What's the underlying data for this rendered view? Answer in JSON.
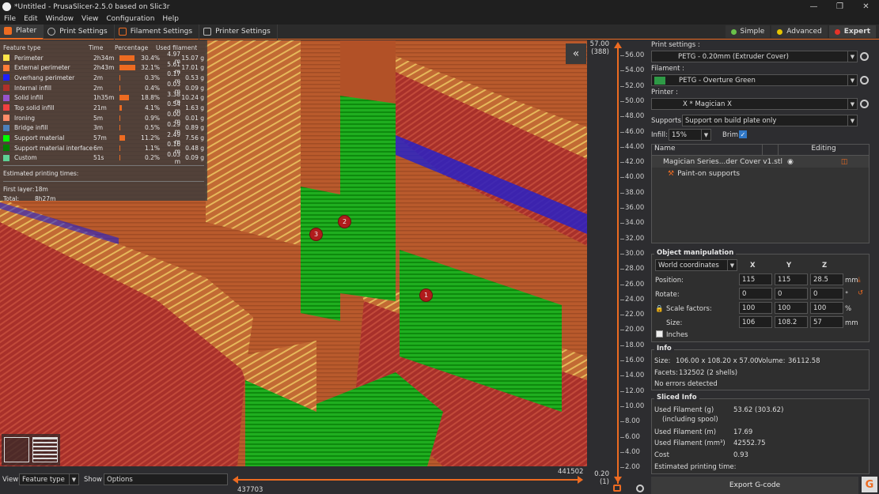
{
  "window": {
    "title": "*Untitled - PrusaSlicer-2.5.0 based on Slic3r",
    "min": "—",
    "max": "❐",
    "close": "✕"
  },
  "menu": [
    "File",
    "Edit",
    "Window",
    "View",
    "Configuration",
    "Help"
  ],
  "tabs": [
    {
      "label": "Plater",
      "icon": "plater-icon"
    },
    {
      "label": "Print Settings",
      "icon": "print-settings-icon"
    },
    {
      "label": "Filament Settings",
      "icon": "filament-icon"
    },
    {
      "label": "Printer Settings",
      "icon": "printer-icon"
    }
  ],
  "modes": [
    {
      "label": "Simple",
      "color": "#6ac24a"
    },
    {
      "label": "Advanced",
      "color": "#e5c400"
    },
    {
      "label": "Expert",
      "color": "#e63228"
    }
  ],
  "legend": {
    "headers": [
      "Feature type",
      "Time",
      "Percentage",
      "Used filament"
    ],
    "rows": [
      {
        "name": "Perimeter",
        "color": "#ffe54a",
        "time": "2h34m",
        "pct": "30.4%",
        "pctv": 30.4,
        "len": "4.97 m",
        "wt": "15.07 g"
      },
      {
        "name": "External perimeter",
        "color": "#ff7d38",
        "time": "2h43m",
        "pct": "32.1%",
        "pctv": 32.1,
        "len": "5.61 m",
        "wt": "17.01 g"
      },
      {
        "name": "Overhang perimeter",
        "color": "#1f1fff",
        "time": "2m",
        "pct": "0.3%",
        "pctv": 0.3,
        "len": "0.17 m",
        "wt": "0.53 g"
      },
      {
        "name": "Internal infill",
        "color": "#b03029",
        "time": "2m",
        "pct": "0.4%",
        "pctv": 0.4,
        "len": "0.03 m",
        "wt": "0.09 g"
      },
      {
        "name": "Solid infill",
        "color": "#9654cc",
        "time": "1h35m",
        "pct": "18.8%",
        "pctv": 18.8,
        "len": "3.38 m",
        "wt": "10.24 g"
      },
      {
        "name": "Top solid infill",
        "color": "#f04040",
        "time": "21m",
        "pct": "4.1%",
        "pctv": 4.1,
        "len": "0.54 m",
        "wt": "1.63 g"
      },
      {
        "name": "Ironing",
        "color": "#ff8c69",
        "time": "5m",
        "pct": "0.9%",
        "pctv": 0.9,
        "len": "0.00 m",
        "wt": "0.01 g"
      },
      {
        "name": "Bridge infill",
        "color": "#4d80ba",
        "time": "3m",
        "pct": "0.5%",
        "pctv": 0.5,
        "len": "0.29 m",
        "wt": "0.89 g"
      },
      {
        "name": "Support material",
        "color": "#00ff00",
        "time": "57m",
        "pct": "11.2%",
        "pctv": 11.2,
        "len": "2.49 m",
        "wt": "7.56 g"
      },
      {
        "name": "Support material interface",
        "color": "#008000",
        "time": "6m",
        "pct": "1.1%",
        "pctv": 1.1,
        "len": "0.16 m",
        "wt": "0.48 g"
      },
      {
        "name": "Custom",
        "color": "#5ed194",
        "time": "51s",
        "pct": "0.2%",
        "pctv": 0.2,
        "len": "0.03 m",
        "wt": "0.09 g"
      }
    ],
    "est_title": "Estimated printing times:",
    "first_layer_label": "First layer:",
    "first_layer": "18m",
    "total_label": "Total:",
    "total": "8h27m"
  },
  "markers": [
    "1",
    "2",
    "3"
  ],
  "vslider": {
    "top": "57.00",
    "top_layer": "(388)",
    "bottom": "0.20",
    "bottom_layer": "(1)",
    "ticks": [
      "56.00",
      "54.00",
      "52.00",
      "50.00",
      "48.00",
      "46.00",
      "44.00",
      "42.00",
      "40.00",
      "38.00",
      "36.00",
      "34.00",
      "32.00",
      "30.00",
      "28.00",
      "26.00",
      "24.00",
      "22.00",
      "20.00",
      "18.00",
      "16.00",
      "14.00",
      "12.00",
      "10.00",
      "8.00",
      "6.00",
      "4.00",
      "2.00"
    ]
  },
  "hslider": {
    "right": "441502",
    "left": "437703"
  },
  "bottom": {
    "view_label": "View",
    "view_value": "Feature type",
    "show_label": "Show",
    "show_value": "Options"
  },
  "sidebar": {
    "print_label": "Print settings :",
    "print_value": "PETG - 0.20mm (Extruder Cover)",
    "filament_label": "Filament :",
    "filament_value": "PETG - Overture Green",
    "filament_color": "#2e9a46",
    "printer_label": "Printer :",
    "printer_value": "X * Magician X",
    "supports_label": "Supports:",
    "supports_value": "Support on build plate only",
    "infill_label": "Infill:",
    "infill_value": "15%",
    "brim_label": "Brim:",
    "list_name_header": "Name",
    "list_editing_header": "Editing",
    "object_name": "Magician Series...der Cover v1.stl",
    "paint_label": "Paint-on supports",
    "objman_title": "Object manipulation",
    "coords": "World coordinates",
    "axes": [
      "X",
      "Y",
      "Z"
    ],
    "position_label": "Position:",
    "position": [
      "115",
      "115",
      "28.5"
    ],
    "position_unit": "mm",
    "rotate_label": "Rotate:",
    "rotate": [
      "0",
      "0",
      "0"
    ],
    "rotate_unit": "°",
    "scale_label": "Scale factors:",
    "scale": [
      "100",
      "100",
      "100"
    ],
    "scale_unit": "%",
    "size_label": "Size:",
    "size": [
      "106",
      "108.2",
      "57"
    ],
    "size_unit": "mm",
    "inches_label": "Inches",
    "info_title": "Info",
    "info_size_label": "Size:",
    "info_size": "106.00 x 108.20 x 57.00",
    "volume_label": "Volume:",
    "volume": "36112.58",
    "facets_label": "Facets:",
    "facets": "132502 (2 shells)",
    "errors": "No errors detected",
    "sliced_title": "Sliced Info",
    "used_g_label": "Used Filament (g)",
    "used_g_sub": "(including spool)",
    "used_g": "53.62 (303.62)",
    "used_m_label": "Used Filament (m)",
    "used_m": "17.69",
    "used_mm3_label": "Used Filament (mm³)",
    "used_mm3": "42552.75",
    "cost_label": "Cost",
    "cost": "0.93",
    "est_label": "Estimated printing time:",
    "export_label": "Export G-code"
  }
}
